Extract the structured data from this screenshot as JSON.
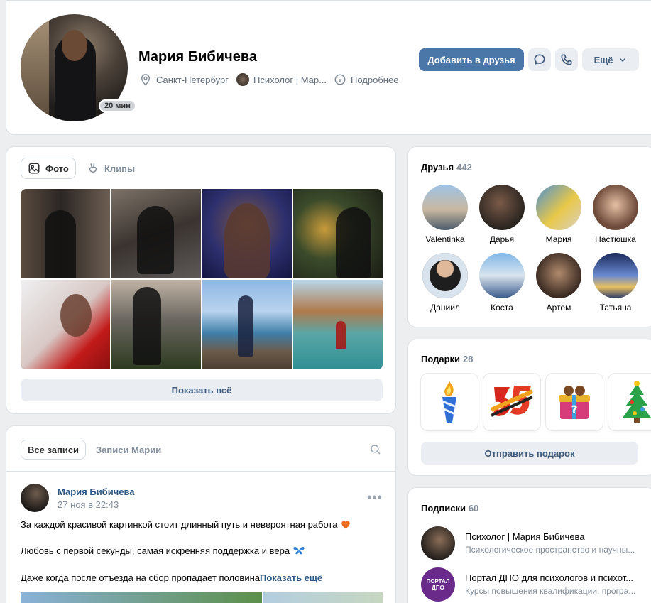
{
  "profile": {
    "name": "Мария Бибичева",
    "online_badge": "20 мин",
    "city": "Санкт-Петербург",
    "work": "Психолог | Мар...",
    "details": "Подробнее",
    "add_friend": "Добавить в друзья",
    "more": "Ещё",
    "accent_color": "#4a76a8"
  },
  "photos": {
    "tabs": [
      "Фото",
      "Клипы"
    ],
    "show_all": "Показать всё"
  },
  "wall": {
    "tabs": [
      "Все записи",
      "Записи Марии"
    ],
    "post": {
      "author": "Мария Бибичева",
      "date": "27 ноя в 22:43",
      "line1": "За каждой красивой картинкой стоит длинный путь и невероятная работа",
      "line2": "Любовь с первой секунды, самая искренняя поддержка и вера",
      "line3": "Даже когда после отъезда на сбор пропадает половина",
      "show_more": "Показать ещё"
    }
  },
  "friends": {
    "title": "Друзья",
    "count": "442",
    "items": [
      {
        "name": "Valentinka"
      },
      {
        "name": "Дарья"
      },
      {
        "name": "Мария"
      },
      {
        "name": "Настюшка"
      },
      {
        "name": "Даниил"
      },
      {
        "name": "Коста"
      },
      {
        "name": "Артем"
      },
      {
        "name": "Татьяна"
      }
    ]
  },
  "gifts": {
    "title": "Подарки",
    "count": "28",
    "icons": [
      "torch-gift-icon",
      "number-gift-icon",
      "surprise-box-gift-icon",
      "christmas-tree-gift-icon"
    ],
    "send": "Отправить подарок"
  },
  "subscriptions": {
    "title": "Подписки",
    "count": "60",
    "items": [
      {
        "title": "Психолог | Мария Бибичева",
        "subtitle": "Психологическое пространство и научны..."
      },
      {
        "title": "Портал ДПО для психологов и психот...",
        "subtitle": "Курсы повышения квалификации, програ...",
        "logo_text": "ПОРТАЛ ДПО"
      }
    ]
  }
}
